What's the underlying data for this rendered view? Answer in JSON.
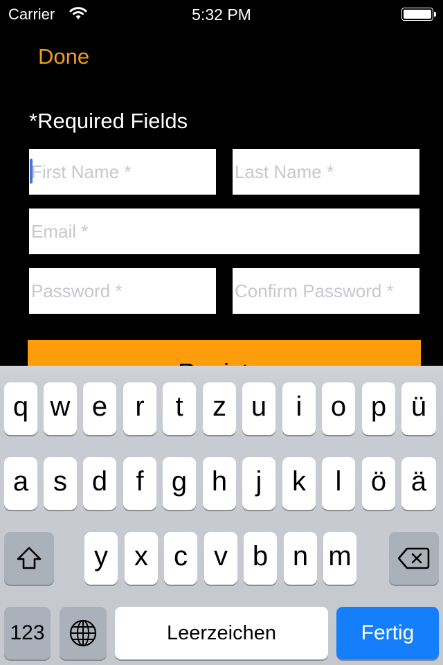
{
  "status_bar": {
    "carrier": "Carrier",
    "wifi_icon": "wifi-icon",
    "time": "5:32 PM",
    "battery_icon": "battery-icon",
    "battery_level": 1.0
  },
  "nav": {
    "done_label": "Done",
    "accent_color": "#f39c1e"
  },
  "form": {
    "required_label": "*Required Fields",
    "fields": {
      "first_name": {
        "value": "",
        "placeholder": "First Name *",
        "focused": true
      },
      "last_name": {
        "value": "",
        "placeholder": "Last Name *"
      },
      "email": {
        "value": "",
        "placeholder": "Email *"
      },
      "password": {
        "value": "",
        "placeholder": "Password *"
      },
      "confirm_password": {
        "value": "",
        "placeholder": "Confirm Password *"
      }
    },
    "register_label": "Register",
    "register_color": "#ff9c0a"
  },
  "keyboard": {
    "layout": "German QWERTZ",
    "row1": [
      "q",
      "w",
      "e",
      "r",
      "t",
      "z",
      "u",
      "i",
      "o",
      "p",
      "ü"
    ],
    "row2": [
      "a",
      "s",
      "d",
      "f",
      "g",
      "h",
      "j",
      "k",
      "l",
      "ö",
      "ä"
    ],
    "row3": [
      "y",
      "x",
      "c",
      "v",
      "b",
      "n",
      "m"
    ],
    "shift_icon": "shift-icon",
    "delete_icon": "backspace-icon",
    "numbers_label": "123",
    "globe_icon": "globe-icon",
    "space_label": "Leerzeichen",
    "return_label": "Fertig",
    "return_color": "#157efb"
  }
}
